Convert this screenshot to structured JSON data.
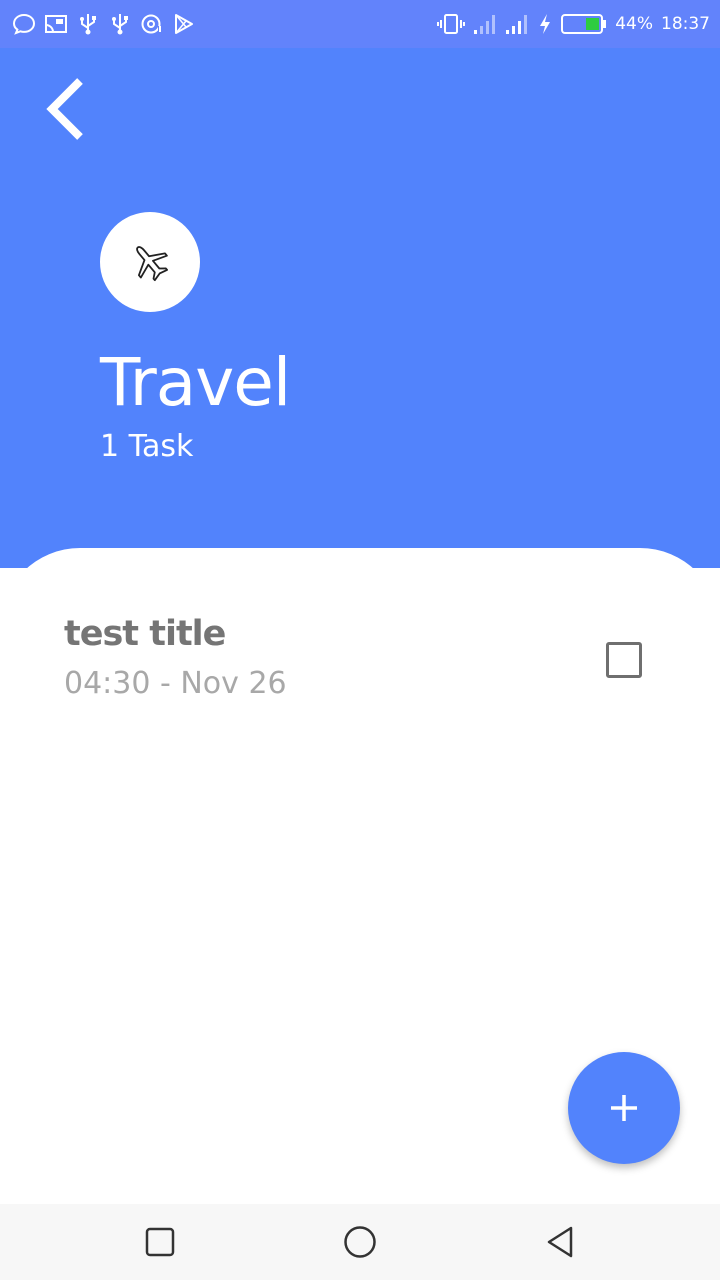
{
  "status_bar": {
    "battery_percent": "44%",
    "time": "18:37",
    "left_icons": [
      "message-icon",
      "cast-icon",
      "usb-icon",
      "usb-icon",
      "sync-icon",
      "play-store-icon"
    ],
    "right_icons": [
      "vibrate-icon",
      "signal-icon",
      "signal-icon",
      "charging-icon",
      "battery-icon"
    ],
    "battery_fill_color": "#2ecc40"
  },
  "header": {
    "background_color": "#5283fc",
    "title": "Travel",
    "task_count": "1 Task",
    "category_icon": "airplane-icon"
  },
  "tasks": [
    {
      "title": "test title",
      "time": "04:30 - Nov 26",
      "checked": false
    }
  ],
  "fab": {
    "icon": "plus-icon",
    "color": "#5283fc"
  },
  "nav_bar": {
    "icons": [
      "recent-apps-icon",
      "home-icon",
      "back-icon"
    ]
  }
}
